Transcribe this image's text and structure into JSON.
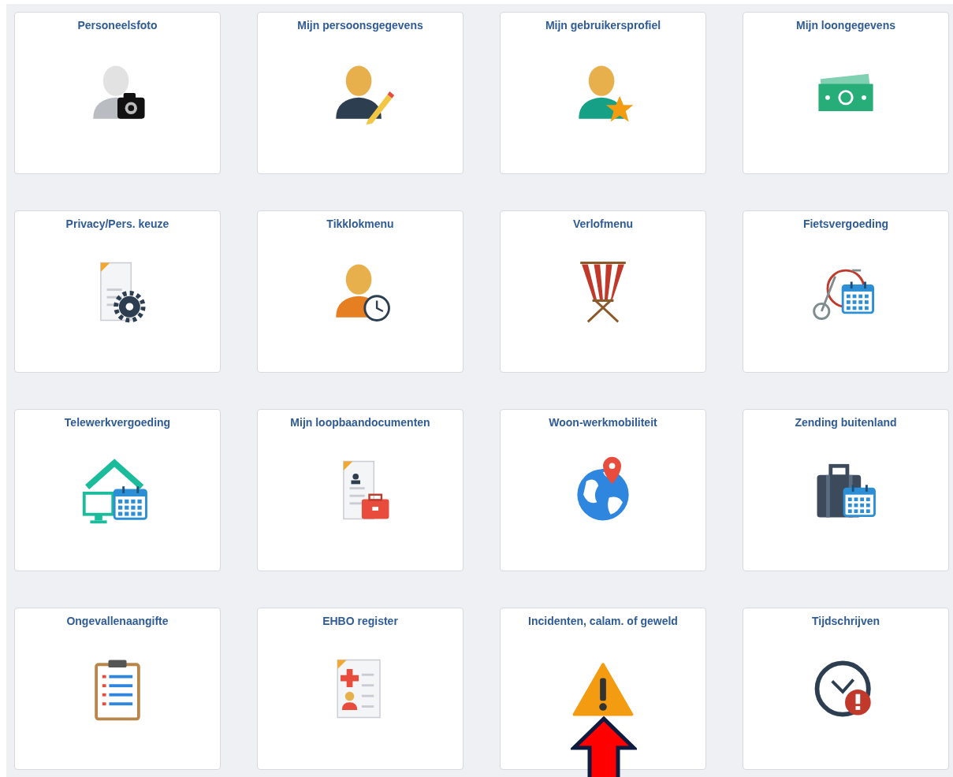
{
  "tiles": [
    {
      "label": "Personeelsfoto",
      "kind": "person-camera",
      "marked": false
    },
    {
      "label": "Mijn persoonsgegevens",
      "kind": "person-pencil",
      "marked": false
    },
    {
      "label": "Mijn gebruikersprofiel",
      "kind": "person-star",
      "marked": false
    },
    {
      "label": "Mijn loongegevens",
      "kind": "money",
      "marked": false
    },
    {
      "label": "Privacy/Pers. keuze",
      "kind": "document-gear",
      "marked": false
    },
    {
      "label": "Tikklokmenu",
      "kind": "person-clock",
      "marked": false
    },
    {
      "label": "Verlofmenu",
      "kind": "deckchair",
      "marked": false
    },
    {
      "label": "Fietsvergoeding",
      "kind": "bicycle-calendar",
      "marked": false
    },
    {
      "label": "Telewerkvergoeding",
      "kind": "house-calendar",
      "marked": false
    },
    {
      "label": "Mijn loopbaandocumenten",
      "kind": "document-briefcase",
      "marked": false
    },
    {
      "label": "Woon-werkmobiliteit",
      "kind": "globe-pin",
      "marked": false
    },
    {
      "label": "Zending buitenland",
      "kind": "suitcase-calendar",
      "marked": false
    },
    {
      "label": "Ongevallenaangifte",
      "kind": "clipboard",
      "marked": false
    },
    {
      "label": "EHBO register",
      "kind": "first-aid-document",
      "marked": false
    },
    {
      "label": "Incidenten, calam. of geweld",
      "kind": "warning",
      "marked": true
    },
    {
      "label": "Tijdschrijven",
      "kind": "clock-alert",
      "marked": false
    }
  ]
}
